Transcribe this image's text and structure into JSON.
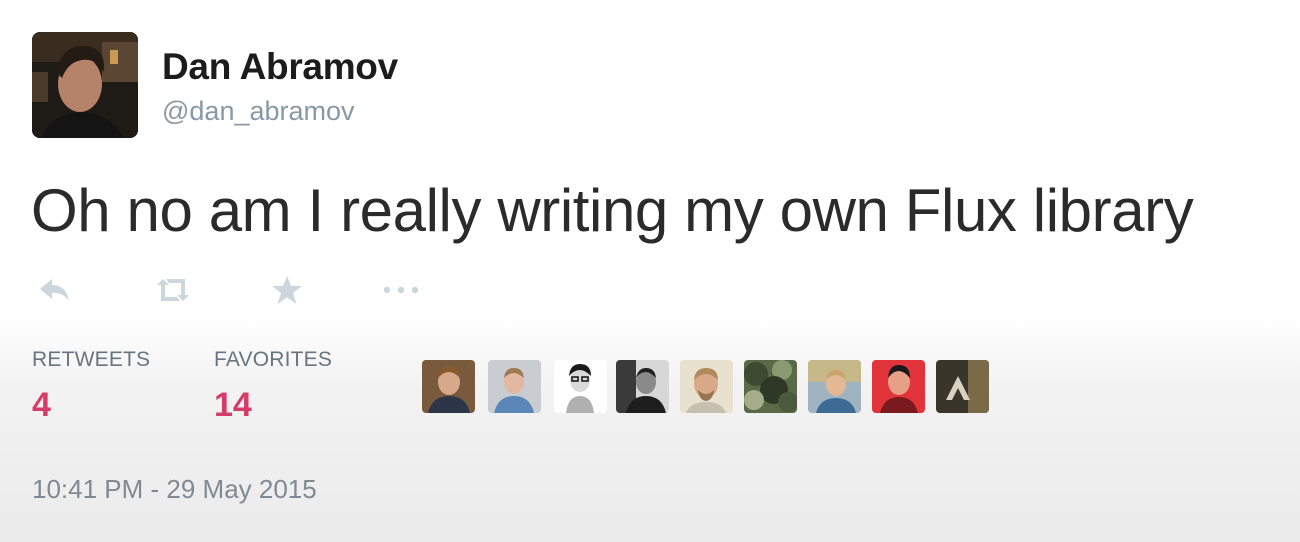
{
  "tweet": {
    "author": {
      "name": "Dan Abramov",
      "handle": "@dan_abramov"
    },
    "text": "Oh no am I really writing my own Flux library",
    "actions": [
      {
        "icon": "reply-icon"
      },
      {
        "icon": "retweet-icon"
      },
      {
        "icon": "favorite-star-icon"
      },
      {
        "icon": "more-dots-icon"
      }
    ],
    "stats": {
      "retweets_label": "RETWEETS",
      "retweets_count": "4",
      "favorites_label": "FAVORITES",
      "favorites_count": "14"
    },
    "favorited_by_count_shown": 9,
    "timestamp": "10:41 PM - 29 May 2015",
    "colors": {
      "count_accent": "#d43d6a",
      "secondary_text": "#8899a6",
      "action_icon": "#ccd6dd"
    }
  }
}
